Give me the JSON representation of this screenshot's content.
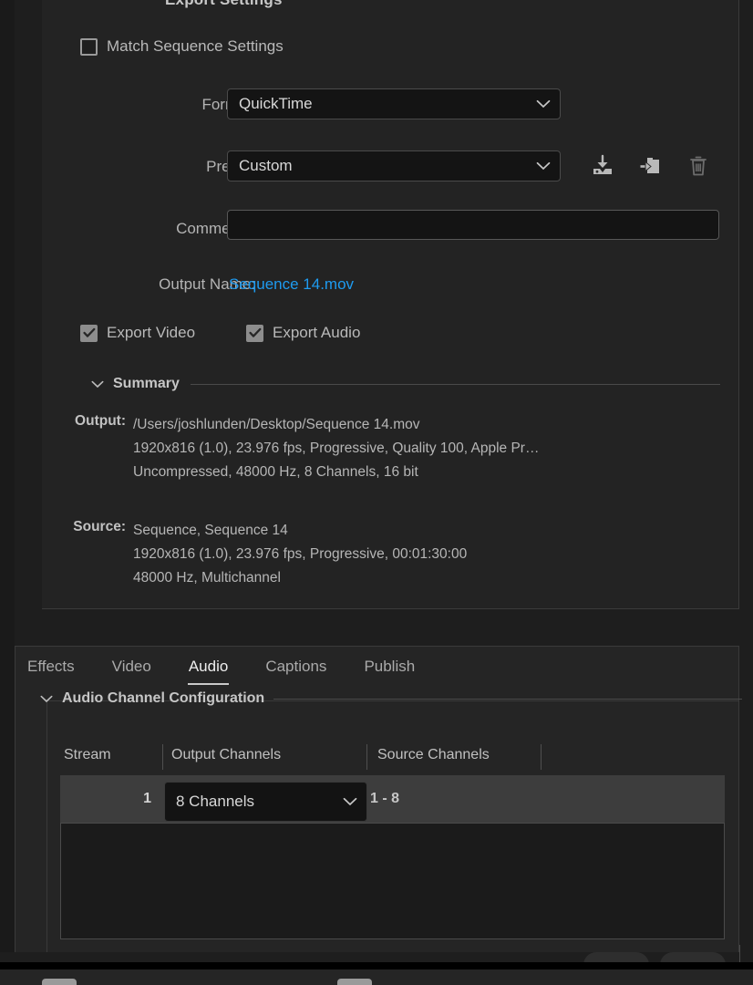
{
  "panel": {
    "title": "Export Settings",
    "match_sequence_label": "Match Sequence Settings",
    "format_label": "Format:",
    "format_value": "QuickTime",
    "preset_label": "Preset:",
    "preset_value": "Custom",
    "comments_label": "Comments:",
    "comments_value": "",
    "comments_placeholder": "",
    "output_name_label": "Output Name:",
    "output_name_value": "Sequence 14.mov",
    "export_video_label": "Export Video",
    "export_audio_label": "Export Audio",
    "preset_icons": [
      {
        "name": "save-preset-icon",
        "title": "Save Preset"
      },
      {
        "name": "import-preset-icon",
        "title": "Import Preset"
      },
      {
        "name": "delete-preset-icon",
        "title": "Delete Preset"
      }
    ]
  },
  "summary": {
    "heading": "Summary",
    "output_key": "Output:",
    "output_lines": [
      "/Users/joshlunden/Desktop/Sequence 14.mov",
      "1920x816 (1.0), 23.976 fps, Progressive, Quality 100, Apple Pr…",
      "Uncompressed, 48000 Hz, 8 Channels, 16 bit"
    ],
    "source_key": "Source:",
    "source_lines": [
      "Sequence, Sequence 14",
      "1920x816 (1.0), 23.976 fps, Progressive, 00:01:30:00",
      "48000 Hz, Multichannel"
    ]
  },
  "tabs": [
    {
      "label": "Effects",
      "active": false
    },
    {
      "label": "Video",
      "active": false
    },
    {
      "label": "Audio",
      "active": true
    },
    {
      "label": "Captions",
      "active": false
    },
    {
      "label": "Publish",
      "active": false
    }
  ],
  "audio": {
    "section_heading": "Audio Channel Configuration",
    "columns": [
      "Stream",
      "Output Channels",
      "Source Channels"
    ],
    "rows": [
      {
        "stream": "1",
        "output_channels": "8 Channels",
        "source_channels": "1 - 8"
      }
    ]
  },
  "colors": {
    "accent_link": "#1e9bf0",
    "panel_bg": "#232323",
    "window_bg": "#1e1e1e",
    "field_bg": "#141414",
    "row_bg": "#3d3d3d",
    "text": "#b4b4b4"
  }
}
